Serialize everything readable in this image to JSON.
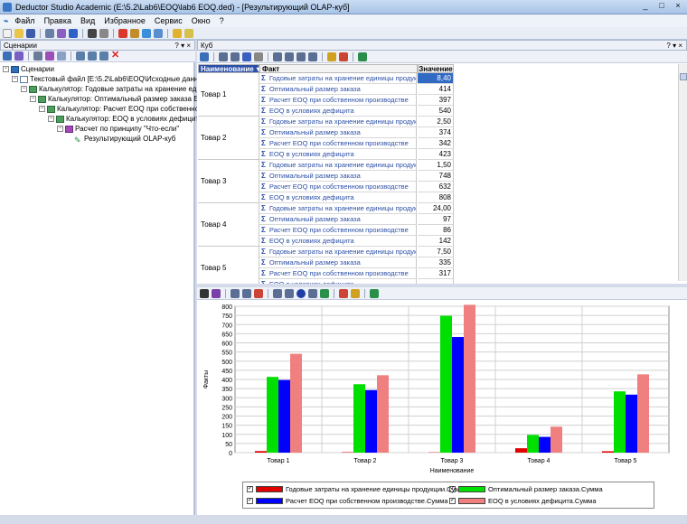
{
  "window": {
    "title": "Deductor Studio Academic (E:\\5.2\\Lab6\\EOQ\\lab6 EOQ.ded) - [Результирующий OLAP-куб]",
    "controls": [
      "_",
      "□",
      "×"
    ]
  },
  "menu": [
    "Файл",
    "Правка",
    "Вид",
    "Избранное",
    "Сервис",
    "Окно",
    "?"
  ],
  "left_panel": {
    "title": "Сценарии",
    "close_label": "? ▾ ×",
    "tree": [
      {
        "label": "Сценарии",
        "level": 0,
        "icon": "scripts-icon"
      },
      {
        "label": "Текстовый файл [E:\\5.2\\Lab6\\EOQ\\Исходные данные для ра",
        "level": 1,
        "icon": "text-file-icon"
      },
      {
        "label": "Калькулятор: Годовые затраты на хранение единицы прод",
        "level": 2,
        "icon": "calculator-icon"
      },
      {
        "label": "Калькулятор: Оптимальный размер заказа EOQ",
        "level": 3,
        "icon": "calculator-icon"
      },
      {
        "label": "Калькулятор: Расчет EOQ при собственном произво",
        "level": 4,
        "icon": "calculator-icon"
      },
      {
        "label": "Калькулятор: EOQ в условиях дефицита",
        "level": 5,
        "icon": "calculator-icon"
      },
      {
        "label": "Расчет по принципу \"Что-если\"",
        "level": 6,
        "icon": "what-if-icon"
      },
      {
        "label": "Результирующий OLAP-куб",
        "level": 7,
        "icon": "olap-cube-icon"
      }
    ]
  },
  "right_panel": {
    "title": "Куб",
    "close_label": "? ▾ ×"
  },
  "grid": {
    "headers": {
      "name": "Наименование",
      "fact": "Факт",
      "value": "Значение"
    },
    "facts": [
      "Годовые затраты на хранение единицы продукции",
      "Оптимальный размер заказа",
      "Расчет EOQ при собственном производстве",
      "EOQ в условиях дефицита"
    ],
    "rows": [
      {
        "name": "Товар 1",
        "values": [
          "8,40",
          "414",
          "397",
          "540"
        ]
      },
      {
        "name": "Товар 2",
        "values": [
          "2,50",
          "374",
          "342",
          "423"
        ]
      },
      {
        "name": "Товар 3",
        "values": [
          "1,50",
          "748",
          "632",
          "808"
        ]
      },
      {
        "name": "Товар 4",
        "values": [
          "24,00",
          "97",
          "86",
          "142"
        ]
      },
      {
        "name": "Товар 5",
        "values": [
          "7,50",
          "335",
          "317",
          ""
        ]
      }
    ]
  },
  "chart_data": {
    "type": "bar",
    "categories": [
      "Товар 1",
      "Товар 2",
      "Товар 3",
      "Товар 4",
      "Товар 5"
    ],
    "series": [
      {
        "name": "Годовые затраты на хранение единицы продукции.Сумма",
        "color": "#e00000",
        "values": [
          8.4,
          2.5,
          1.5,
          24,
          7.5
        ]
      },
      {
        "name": "Оптимальный размер заказа.Сумма",
        "color": "#00e000",
        "values": [
          414,
          374,
          748,
          97,
          335
        ]
      },
      {
        "name": "Расчет EOQ при собственном производстве.Сумма",
        "color": "#0000ff",
        "values": [
          397,
          342,
          632,
          86,
          317
        ]
      },
      {
        "name": "EOQ в условиях дефицита.Сумма",
        "color": "#f08080",
        "values": [
          540,
          423,
          808,
          142,
          428
        ]
      }
    ],
    "xlabel": "Наименование",
    "ylabel": "Факты",
    "ylim": [
      0,
      800
    ],
    "yticks": [
      0,
      50,
      100,
      150,
      200,
      250,
      300,
      350,
      400,
      450,
      500,
      550,
      600,
      650,
      700,
      750,
      800
    ],
    "grid": true,
    "legend": "bottom"
  }
}
